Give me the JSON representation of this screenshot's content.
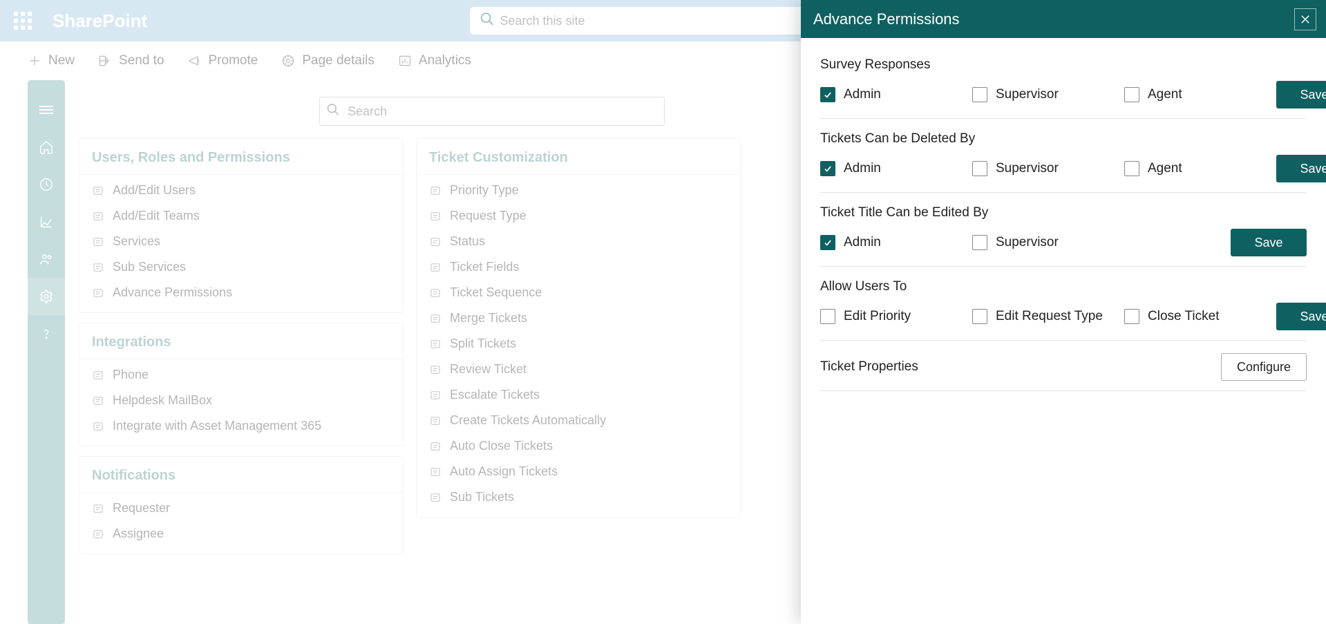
{
  "header": {
    "app_title": "SharePoint",
    "search_placeholder": "Search this site"
  },
  "commands": {
    "new": "New",
    "send_to": "Send to",
    "promote": "Promote",
    "page_details": "Page details",
    "analytics": "Analytics"
  },
  "local_search_placeholder": "Search",
  "cards": {
    "users_roles": {
      "title": "Users, Roles and Permissions",
      "items": [
        "Add/Edit Users",
        "Add/Edit Teams",
        "Services",
        "Sub Services",
        "Advance Permissions"
      ]
    },
    "integrations": {
      "title": "Integrations",
      "items": [
        "Phone",
        "Helpdesk MailBox",
        "Integrate with Asset Management 365"
      ]
    },
    "notifications": {
      "title": "Notifications",
      "items": [
        "Requester",
        "Assignee"
      ]
    },
    "ticket_custom": {
      "title": "Ticket Customization",
      "items": [
        "Priority Type",
        "Request Type",
        "Status",
        "Ticket Fields",
        "Ticket Sequence",
        "Merge Tickets",
        "Split Tickets",
        "Review Ticket",
        "Escalate Tickets",
        "Create Tickets Automatically",
        "Auto Close Tickets",
        "Auto Assign Tickets",
        "Sub Tickets"
      ]
    }
  },
  "panel": {
    "title": "Advance Permissions",
    "save_label": "Save",
    "configure_label": "Configure",
    "sections": [
      {
        "title": "Survey Responses",
        "options": [
          "Admin",
          "Supervisor",
          "Agent"
        ],
        "checked": [
          true,
          false,
          false
        ],
        "action": "save"
      },
      {
        "title": "Tickets Can be Deleted By",
        "options": [
          "Admin",
          "Supervisor",
          "Agent"
        ],
        "checked": [
          true,
          false,
          false
        ],
        "action": "save"
      },
      {
        "title": "Ticket Title Can be Edited By",
        "options": [
          "Admin",
          "Supervisor"
        ],
        "checked": [
          true,
          false
        ],
        "action": "save"
      },
      {
        "title": "Allow Users To",
        "options": [
          "Edit Priority",
          "Edit Request Type",
          "Close Ticket"
        ],
        "checked": [
          false,
          false,
          false
        ],
        "action": "save"
      },
      {
        "title": "Ticket Properties",
        "options": [],
        "checked": [],
        "action": "configure"
      }
    ]
  }
}
